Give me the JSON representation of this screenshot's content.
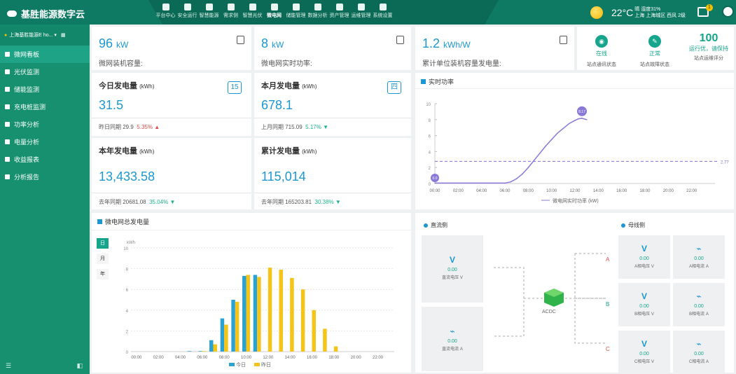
{
  "header": {
    "app_title": "基胜能源数字云",
    "nav": [
      "平台中心",
      "安全运行",
      "智慧能源",
      "需求侧",
      "智慧光伏",
      "微电网",
      "储能管理",
      "数据分析",
      "资产管理",
      "运维管理",
      "系统设置"
    ],
    "active_nav": "微电网",
    "weather": {
      "temp": "22°C",
      "line1": "晴 湿度31%",
      "line2": "上海 上海城区 西风 2级"
    },
    "notify_count": "1"
  },
  "sidebar": {
    "station": "上海基胜能源E ho...",
    "items": [
      "微网看板",
      "光伏监测",
      "储能监测",
      "充电桩监测",
      "功率分析",
      "电量分析",
      "收益报表",
      "分析报告"
    ],
    "active": "微网看板"
  },
  "kpi": [
    {
      "value": "96",
      "unit": "kW",
      "label": "微网装机容量:"
    },
    {
      "value": "8",
      "unit": "kW",
      "label": "微电网实时功率:"
    },
    {
      "value": "1.2",
      "unit": "kWh/W",
      "label": "累计单位装机容量发电量:"
    }
  ],
  "status": {
    "comm": {
      "value": "在线",
      "label": "站点通讯状态"
    },
    "fault": {
      "value": "正常",
      "label": "站点故障状态"
    },
    "score": {
      "value": "100",
      "note": "运行优，请保持",
      "label": "站点运维评分"
    }
  },
  "energy": {
    "today": {
      "title": "今日发电量",
      "unit": "(kWh)",
      "value": "31.5",
      "cmp_label": "昨日同期",
      "cmp_value": "29.9",
      "pct": "5.35%",
      "arrow": "▲",
      "cal": "15"
    },
    "month": {
      "title": "本月发电量",
      "unit": "(kWh)",
      "value": "678.1",
      "cmp_label": "上月同期",
      "cmp_value": "715.09",
      "pct": "5.17%",
      "arrow": "▼",
      "cal": "四"
    },
    "year": {
      "title": "本年发电量",
      "unit": "(kWh)",
      "value": "13,433.58",
      "cmp_label": "去年同期",
      "cmp_value": "20681.08",
      "pct": "35.04%",
      "arrow": "▼"
    },
    "total": {
      "title": "累计发电量",
      "unit": "(kWh)",
      "value": "115,014",
      "cmp_label": "去年同期",
      "cmp_value": "165203.81",
      "pct": "30.38%",
      "arrow": "▼"
    }
  },
  "power_panel": {
    "title": "实时功率",
    "legend": "微电网实时功率 (kW)",
    "start_marker": "0.0",
    "peak_marker": "8.17",
    "avg_label": "2.77"
  },
  "gen_panel": {
    "title": "微电网总发电量",
    "periods": [
      "日",
      "月",
      "年"
    ],
    "active": "日",
    "unit": "kWh",
    "legend_today": "今日",
    "legend_yesterday": "昨日"
  },
  "topology": {
    "dc_title": "直流侧",
    "bus_title": "母线侧",
    "converter": "ACDC",
    "dc_boxes": [
      {
        "value": "0.00",
        "label": "直流电压 V",
        "icon": "voltage-icon"
      },
      {
        "value": "0.00",
        "label": "直流电流 A",
        "icon": "current-icon"
      }
    ],
    "phases": [
      "A",
      "B",
      "C"
    ],
    "bus_boxes": [
      {
        "value": "0.00",
        "label": "A相电压 V",
        "icon": "voltage-icon"
      },
      {
        "value": "0.00",
        "label": "A相电流 A",
        "icon": "current-icon"
      },
      {
        "value": "0.00",
        "label": "B相电压 V",
        "icon": "voltage-icon"
      },
      {
        "value": "0.00",
        "label": "B相电流 A",
        "icon": "current-icon"
      },
      {
        "value": "0.00",
        "label": "C相电压 V",
        "icon": "voltage-icon"
      },
      {
        "value": "0.00",
        "label": "C相电流 A",
        "icon": "current-icon"
      }
    ]
  },
  "chart_data": [
    {
      "type": "line",
      "title": "实时功率",
      "x_ticks": [
        "00:00",
        "02:00",
        "04:00",
        "06:00",
        "08:00",
        "10:00",
        "12:00",
        "14:00",
        "16:00",
        "18:00",
        "20:00",
        "22:00"
      ],
      "ylim": [
        0,
        10
      ],
      "y_ticks": [
        0,
        2,
        4,
        6,
        8,
        10
      ],
      "series": [
        {
          "name": "微电网实时功率 (kW)",
          "points": [
            [
              0,
              0.05
            ],
            [
              6,
              0.05
            ],
            [
              6.5,
              0.2
            ],
            [
              7,
              0.6
            ],
            [
              7.5,
              1.2
            ],
            [
              8,
              2.0
            ],
            [
              8.5,
              2.9
            ],
            [
              9,
              3.8
            ],
            [
              9.5,
              4.7
            ],
            [
              10,
              5.5
            ],
            [
              10.5,
              6.3
            ],
            [
              11,
              6.9
            ],
            [
              11.5,
              7.5
            ],
            [
              12,
              7.9
            ],
            [
              12.3,
              8.1
            ],
            [
              12.6,
              8.17
            ],
            [
              13,
              8.0
            ]
          ]
        }
      ],
      "avg": 2.77
    },
    {
      "type": "bar",
      "title": "微电网总发电量",
      "ylabel": "kWh",
      "ylim": [
        0,
        10
      ],
      "y_ticks": [
        0,
        2,
        4,
        6,
        8,
        10
      ],
      "categories": [
        "00:00",
        "01:00",
        "02:00",
        "03:00",
        "04:00",
        "05:00",
        "06:00",
        "07:00",
        "08:00",
        "09:00",
        "10:00",
        "11:00",
        "12:00",
        "13:00",
        "14:00",
        "15:00",
        "16:00",
        "17:00",
        "18:00",
        "19:00",
        "20:00",
        "21:00",
        "22:00",
        "23:00"
      ],
      "series": [
        {
          "name": "今日",
          "color": "#2aa2d4",
          "values": [
            0,
            0,
            0,
            0,
            0,
            0.05,
            0.05,
            1.1,
            3.2,
            5.0,
            7.3,
            7.4,
            0,
            0,
            0,
            0,
            0,
            0,
            0,
            0,
            0,
            0,
            0,
            0
          ]
        },
        {
          "name": "昨日",
          "color": "#f4c518",
          "values": [
            0,
            0,
            0,
            0,
            0,
            0,
            0.05,
            0.7,
            2.6,
            4.8,
            7.4,
            7.2,
            8.1,
            7.9,
            7.1,
            6.0,
            4.0,
            2.2,
            0.5,
            0,
            0,
            0,
            0,
            0
          ]
        }
      ]
    }
  ]
}
